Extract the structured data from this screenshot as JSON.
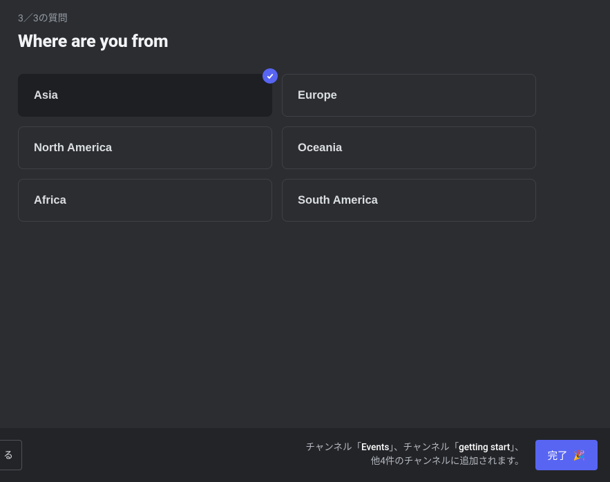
{
  "progress": {
    "text": "3／3の質問"
  },
  "question": {
    "title": "Where are you from"
  },
  "options": [
    {
      "label": "Asia",
      "selected": true
    },
    {
      "label": "Europe",
      "selected": false
    },
    {
      "label": "North America",
      "selected": false
    },
    {
      "label": "Oceania",
      "selected": false
    },
    {
      "label": "Africa",
      "selected": false
    },
    {
      "label": "South America",
      "selected": false
    }
  ],
  "footer": {
    "back_label": "る",
    "text_prefix1": "チャンネル「",
    "channel1": "Events",
    "text_mid1": "」、チャンネル「",
    "channel2": "getting start",
    "text_suffix1": "」、",
    "text_line2": "他4件のチャンネルに追加されます。",
    "complete_label": "完了",
    "party_emoji": "🎉"
  }
}
